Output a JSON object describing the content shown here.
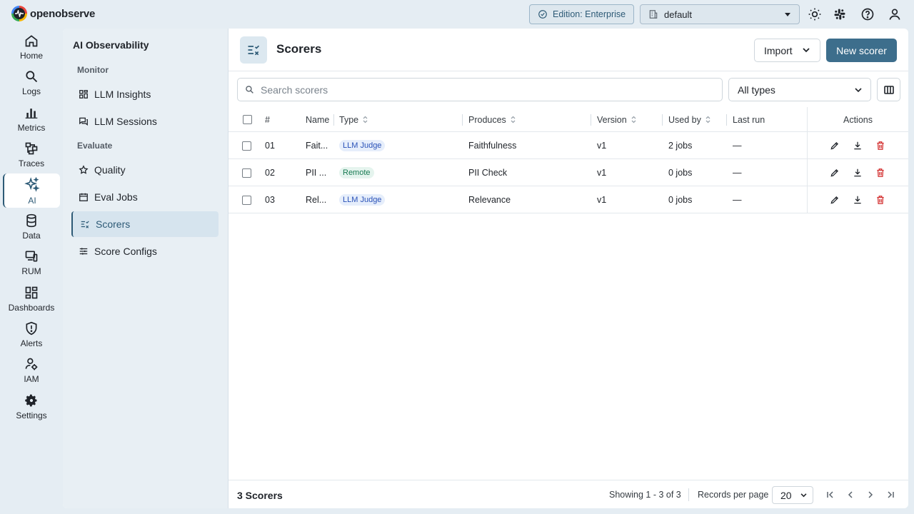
{
  "app": {
    "brand": "openobserve",
    "edition": "Edition: Enterprise",
    "org": "default"
  },
  "rail": [
    {
      "label": "Home",
      "icon": "home-icon"
    },
    {
      "label": "Logs",
      "icon": "search-icon"
    },
    {
      "label": "Metrics",
      "icon": "bar-chart-icon"
    },
    {
      "label": "Traces",
      "icon": "traces-icon"
    },
    {
      "label": "AI",
      "icon": "sparkles-icon",
      "active": true
    },
    {
      "label": "Data",
      "icon": "database-icon"
    },
    {
      "label": "RUM",
      "icon": "devices-icon"
    },
    {
      "label": "Dashboards",
      "icon": "dashboard-icon"
    },
    {
      "label": "Alerts",
      "icon": "alert-shield-icon"
    },
    {
      "label": "IAM",
      "icon": "user-cog-icon"
    },
    {
      "label": "Settings",
      "icon": "gear-icon"
    }
  ],
  "subnav": {
    "title": "AI Observability",
    "monitor_label": "Monitor",
    "evaluate_label": "Evaluate",
    "items": {
      "llm_insights": "LLM Insights",
      "llm_sessions": "LLM Sessions",
      "quality": "Quality",
      "eval_jobs": "Eval Jobs",
      "scorers": "Scorers",
      "score_configs": "Score Configs"
    }
  },
  "header": {
    "title": "Scorers",
    "import_label": "Import",
    "new_label": "New scorer"
  },
  "filters": {
    "search_placeholder": "Search scorers",
    "type_value": "All types"
  },
  "table": {
    "columns": {
      "num": "#",
      "name": "Name",
      "type": "Type",
      "produces": "Produces",
      "version": "Version",
      "used_by": "Used by",
      "last_run": "Last run",
      "actions": "Actions"
    },
    "rows": [
      {
        "num": "01",
        "name": "Fait...",
        "type": "LLM Judge",
        "produces": "Faithfulness",
        "version": "v1",
        "used_by": "2 jobs",
        "last_run": "—"
      },
      {
        "num": "02",
        "name": "PII ...",
        "type": "Remote",
        "produces": "PII Check",
        "version": "v1",
        "used_by": "0 jobs",
        "last_run": "—"
      },
      {
        "num": "03",
        "name": "Rel...",
        "type": "LLM Judge",
        "produces": "Relevance",
        "version": "v1",
        "used_by": "0 jobs",
        "last_run": "—"
      }
    ]
  },
  "footer": {
    "count": "3 Scorers",
    "showing": "Showing 1 - 3 of 3",
    "rpp_label": "Records per page",
    "rpp_value": "20"
  },
  "colors": {
    "accent": "#3d6e8c",
    "danger": "#d32f2f",
    "judge_badge": "#2a52b8",
    "remote_badge": "#187a52"
  }
}
